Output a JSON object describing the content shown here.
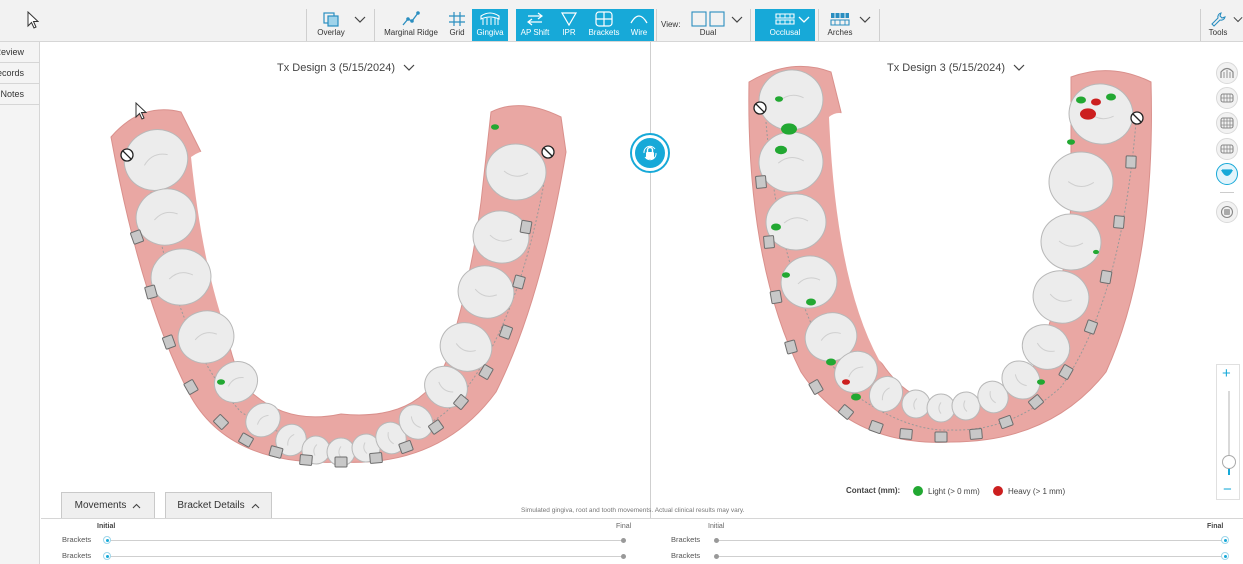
{
  "toolbar": {
    "overlay": "Overlay",
    "marginal_ridge": "Marginal Ridge",
    "grid": "Grid",
    "gingiva": "Gingiva",
    "ap_shift": "AP Shift",
    "ipr": "IPR",
    "brackets": "Brackets",
    "wire": "Wire",
    "view_label": "View:",
    "dual": "Dual",
    "occlusal": "Occlusal",
    "arches": "Arches",
    "tools": "Tools"
  },
  "sidebar": {
    "items": [
      {
        "label": "Review"
      },
      {
        "label": "Records"
      },
      {
        "label": "Notes"
      }
    ]
  },
  "left_view": {
    "title": "Tx Design 3 (5/15/2024)"
  },
  "right_view": {
    "title": "Tx Design 3 (5/15/2024)"
  },
  "bottom": {
    "tabs": [
      {
        "label": "Movements"
      },
      {
        "label": "Bracket Details"
      }
    ],
    "disclaimer": "Simulated gingiva, root and tooth movements. Actual clinical results may vary.",
    "left_timeline": {
      "initial": "Initial",
      "final": "Final",
      "rows": [
        "Brackets",
        "Brackets"
      ]
    },
    "right_timeline": {
      "initial": "Initial",
      "final": "Final",
      "rows": [
        "Brackets",
        "Brackets"
      ]
    }
  },
  "legend": {
    "title": "Contact (mm):",
    "items": [
      {
        "label": "Light (> 0 mm)",
        "color": "#22a832"
      },
      {
        "label": "Heavy (> 1 mm)",
        "color": "#cc1f1f"
      }
    ]
  },
  "zoom": {
    "plus": "+",
    "minus": "−",
    "level": 0.15
  },
  "colors": {
    "accent": "#17a9d8",
    "gingiva": "#e9a7a3",
    "tooth": "#ececec",
    "contact_light": "#22a832",
    "contact_heavy": "#cc1f1f"
  }
}
